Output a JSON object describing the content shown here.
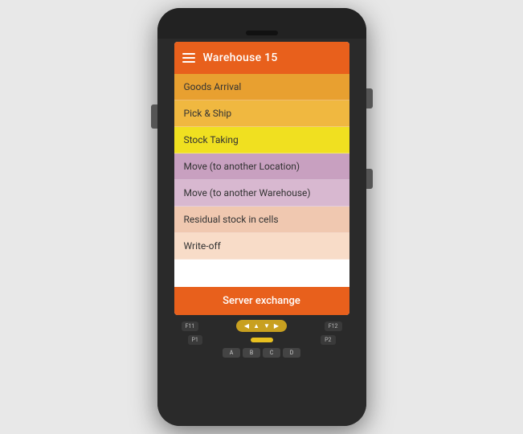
{
  "app": {
    "header": {
      "title": "Warehouse 15",
      "menu_icon_label": "menu"
    },
    "menu_items": [
      {
        "label": "Goods Arrival",
        "bg": "#e8a030",
        "color": "#333"
      },
      {
        "label": "Pick & Ship",
        "bg": "#f0b840",
        "color": "#333"
      },
      {
        "label": "Stock Taking",
        "bg": "#f0e020",
        "color": "#333"
      },
      {
        "label": "Move (to another Location)",
        "bg": "#c8a0c0",
        "color": "#333"
      },
      {
        "label": "Move (to another Warehouse)",
        "bg": "#d8b8d0",
        "color": "#333"
      },
      {
        "label": "Residual stock in cells",
        "bg": "#f0c8b0",
        "color": "#333"
      },
      {
        "label": "Write-off",
        "bg": "#f8dcc8",
        "color": "#333"
      }
    ],
    "server_button": "Server exchange"
  },
  "keypad": {
    "fn_left": "F11",
    "fn_right": "F12",
    "p1": "P1",
    "p2": "P2",
    "alpha_keys": [
      "A",
      "B",
      "C",
      "D"
    ]
  }
}
